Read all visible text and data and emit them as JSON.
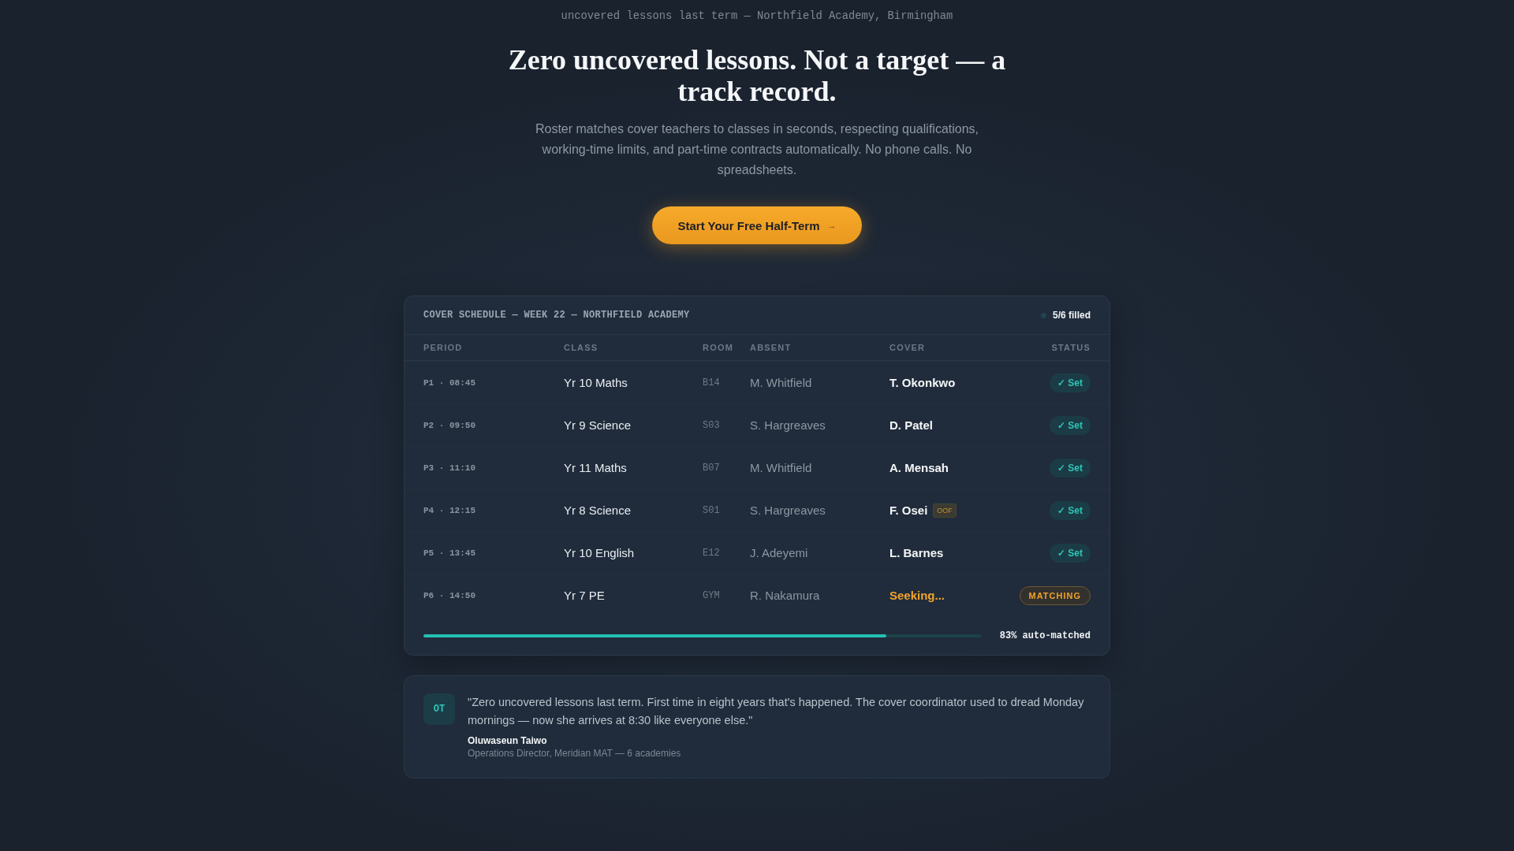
{
  "eyebrow": "uncovered lessons last term — Northfield Academy, Birmingham",
  "headline": "Zero uncovered lessons. Not a target — a track record.",
  "subheadline": "Roster matches cover teachers to classes in seconds, respecting qualifications, working-time limits, and part-time contracts automatically. No phone calls. No spreadsheets.",
  "cta": {
    "label": "Start Your Free Half-Term",
    "arrow": "→"
  },
  "schedule": {
    "title": "COVER SCHEDULE — WEEK 22 — NORTHFIELD ACADEMY",
    "filled": "5/6 filled",
    "columns": [
      "PERIOD",
      "CLASS",
      "ROOM",
      "ABSENT",
      "COVER",
      "STATUS"
    ],
    "rows": [
      {
        "period": "P1 · 08:45",
        "class": "Yr 10 Maths",
        "room": "B14",
        "absent": "M. Whitfield",
        "cover": {
          "kind": "assigned",
          "name": "T. Okonkwo"
        },
        "status": {
          "kind": "set",
          "label": "✓ Set"
        }
      },
      {
        "period": "P2 · 09:50",
        "class": "Yr 9 Science",
        "room": "S03",
        "absent": "S. Hargreaves",
        "cover": {
          "kind": "assigned",
          "name": "D. Patel"
        },
        "status": {
          "kind": "set",
          "label": "✓ Set"
        }
      },
      {
        "period": "P3 · 11:10",
        "class": "Yr 11 Maths",
        "room": "B07",
        "absent": "M. Whitfield",
        "cover": {
          "kind": "assigned",
          "name": "A. Mensah"
        },
        "status": {
          "kind": "set",
          "label": "✓ Set"
        }
      },
      {
        "period": "P4 · 12:15",
        "class": "Yr 8 Science",
        "room": "S01",
        "absent": "S. Hargreaves",
        "cover": {
          "kind": "assigned",
          "name": "F. Osei",
          "tag": "OOF"
        },
        "status": {
          "kind": "set",
          "label": "✓ Set"
        }
      },
      {
        "period": "P5 · 13:45",
        "class": "Yr 10 English",
        "room": "E12",
        "absent": "J. Adeyemi",
        "cover": {
          "kind": "assigned",
          "name": "L. Barnes"
        },
        "status": {
          "kind": "set",
          "label": "✓ Set"
        }
      },
      {
        "period": "P6 · 14:50",
        "class": "Yr 7 PE",
        "room": "GYM",
        "absent": "R. Nakamura",
        "cover": {
          "kind": "seeking",
          "name": "Seeking..."
        },
        "status": {
          "kind": "matching",
          "label": "MATCHING"
        }
      }
    ],
    "progress": {
      "level": 0.83,
      "label": "83% auto-matched"
    }
  },
  "testimonial": {
    "initials": "OT",
    "quote": "\"Zero uncovered lessons last term. First time in eight years that's happened. The cover coordinator used to dread Monday mornings — now she arrives at 8:30 like everyone else.\"",
    "name": "Oluwaseun Taiwo",
    "role": "Operations Director, Meridian MAT — 6 academies"
  }
}
